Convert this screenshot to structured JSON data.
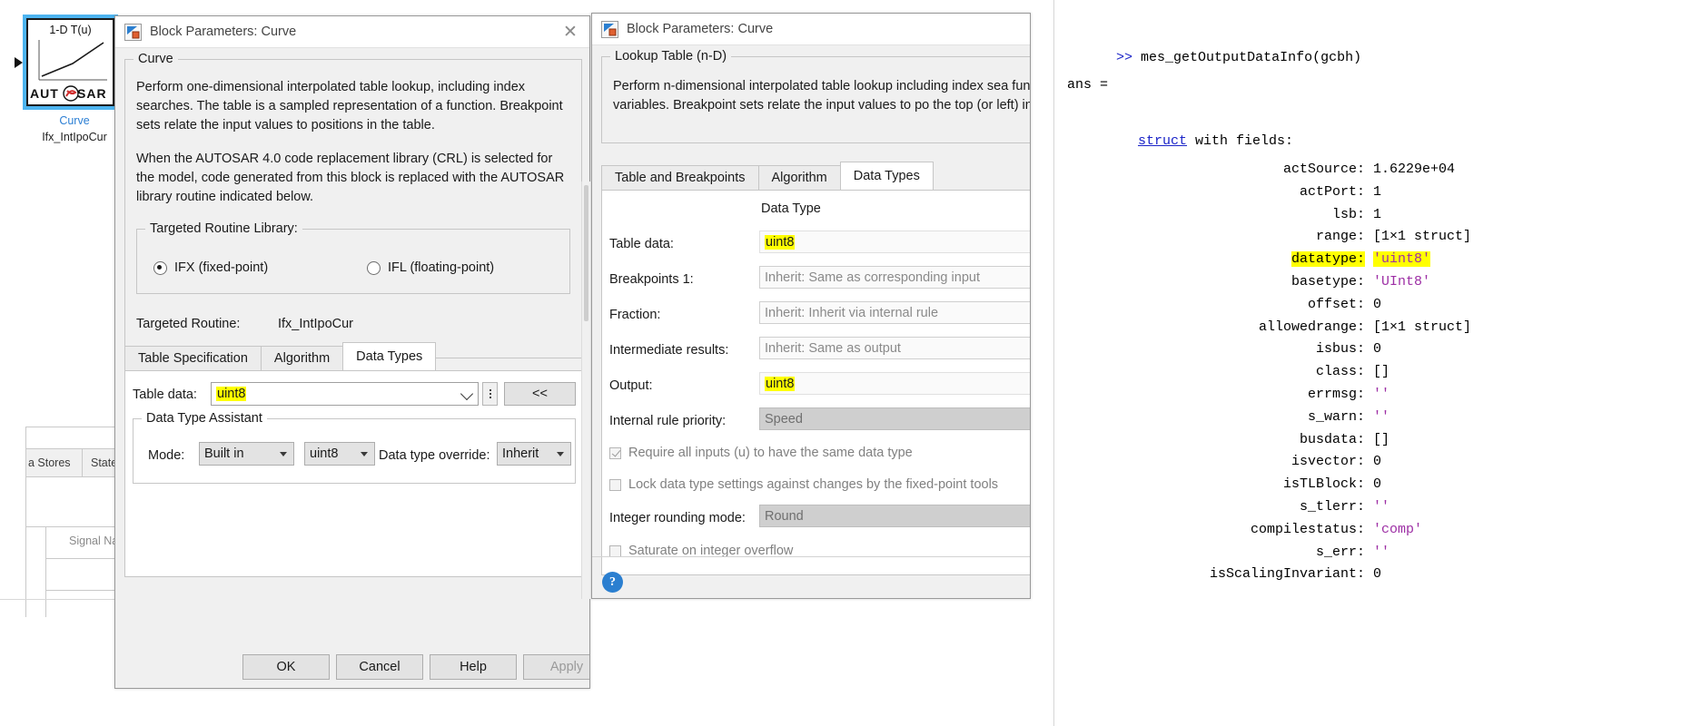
{
  "block": {
    "title": "1-D T(u)",
    "logo_text": "AUT SAR",
    "name": "Curve",
    "routine": "Ifx_IntIpoCur",
    "port_in_icon": "input-port-arrow-icon",
    "port_out_icon": "output-port-arrow-icon"
  },
  "background_table": {
    "tabs": [
      "a Stores",
      "States"
    ],
    "column_header": "Signal Na"
  },
  "dialog1": {
    "title": "Block Parameters: Curve",
    "icon": "simulink-block-icon",
    "close_label": "✕",
    "group_legend": "Curve",
    "description_1": "Perform one-dimensional interpolated table lookup, including index searches. The table is a sampled representation of a function. Breakpoint sets relate the input values to positions in the table.",
    "description_2": "When the AUTOSAR 4.0 code replacement library (CRL) is selected for the model, code generated from this block is replaced with the AUTOSAR library routine indicated below.",
    "routine_group_legend": "Targeted Routine Library:",
    "radio_ifx": "IFX (fixed-point)",
    "radio_ifl": "IFL (floating-point)",
    "radio_selected": "IFX (fixed-point)",
    "targeted_routine_label": "Targeted Routine:",
    "targeted_routine_value": "Ifx_IntIpoCur",
    "tabs": [
      "Table Specification",
      "Algorithm",
      "Data Types"
    ],
    "active_tab": "Data Types",
    "table_data_label": "Table data:",
    "table_data_value": "uint8",
    "dots_button": "more-options-button",
    "collapse_button": "<<",
    "assistant_legend": "Data Type Assistant",
    "mode_label": "Mode:",
    "mode_value": "Built in",
    "builtin_type_value": "uint8",
    "override_label": "Data type override:",
    "override_value": "Inherit",
    "buttons": [
      "OK",
      "Cancel",
      "Help",
      "Apply"
    ],
    "apply_disabled": true
  },
  "dialog2": {
    "title": "Block Parameters: Curve",
    "icon": "simulink-block-icon",
    "group_legend": "Lookup Table (n-D)",
    "description": "Perform n-dimensional interpolated table lookup including index sea function in N variables. Breakpoint sets relate the input values to po the top (or left) input port.",
    "tabs": [
      "Table and Breakpoints",
      "Algorithm",
      "Data Types"
    ],
    "active_tab": "Data Types",
    "column_header": "Data Type",
    "rows": [
      {
        "label": "Table data:",
        "value": "uint8",
        "highlight": true,
        "style": "plain"
      },
      {
        "label": "Breakpoints 1:",
        "value": "Inherit: Same as corresponding input",
        "highlight": false,
        "style": "readonly"
      },
      {
        "label": "Fraction:",
        "value": "Inherit: Inherit via internal rule",
        "highlight": false,
        "style": "readonly"
      },
      {
        "label": "Intermediate results:",
        "value": "Inherit: Same as output",
        "highlight": false,
        "style": "readonly"
      },
      {
        "label": "Output:",
        "value": "uint8",
        "highlight": true,
        "style": "plain"
      },
      {
        "label": "Internal rule priority:",
        "value": "Speed",
        "highlight": false,
        "style": "greyed"
      }
    ],
    "checkboxes": [
      {
        "label": "Require all inputs (u) to have the same data type",
        "checked": true
      },
      {
        "label": "Lock data type settings against changes by the fixed-point tools",
        "checked": false
      },
      {
        "label": "Saturate on integer overflow",
        "checked": false
      }
    ],
    "rounding_label": "Integer rounding mode:",
    "rounding_value": "Round",
    "help_icon": "help-question-icon"
  },
  "console": {
    "prompt": ">>",
    "command": "mes_getOutputDataInfo(gcbh)",
    "ans_line": "ans =",
    "struct_keyword": "struct",
    "struct_suffix": " with fields:",
    "fields": [
      {
        "name": "actSource",
        "value": "1.6229e+04",
        "type": "num",
        "highlight": false
      },
      {
        "name": "actPort",
        "value": "1",
        "type": "num",
        "highlight": false
      },
      {
        "name": "lsb",
        "value": "1",
        "type": "num",
        "highlight": false
      },
      {
        "name": "range",
        "value": "[1×1 struct]",
        "type": "num",
        "highlight": false
      },
      {
        "name": "datatype",
        "value": "'uint8'",
        "type": "str",
        "highlight": true
      },
      {
        "name": "basetype",
        "value": "'UInt8'",
        "type": "str",
        "highlight": false
      },
      {
        "name": "offset",
        "value": "0",
        "type": "num",
        "highlight": false
      },
      {
        "name": "allowedrange",
        "value": "[1×1 struct]",
        "type": "num",
        "highlight": false
      },
      {
        "name": "isbus",
        "value": "0",
        "type": "num",
        "highlight": false
      },
      {
        "name": "class",
        "value": "[]",
        "type": "num",
        "highlight": false
      },
      {
        "name": "errmsg",
        "value": "''",
        "type": "str",
        "highlight": false
      },
      {
        "name": "s_warn",
        "value": "''",
        "type": "str",
        "highlight": false
      },
      {
        "name": "busdata",
        "value": "[]",
        "type": "num",
        "highlight": false
      },
      {
        "name": "isvector",
        "value": "0",
        "type": "num",
        "highlight": false
      },
      {
        "name": "isTLBlock",
        "value": "0",
        "type": "num",
        "highlight": false
      },
      {
        "name": "s_tlerr",
        "value": "''",
        "type": "str",
        "highlight": false
      },
      {
        "name": "compilestatus",
        "value": "'comp'",
        "type": "str",
        "highlight": false
      },
      {
        "name": "s_err",
        "value": "''",
        "type": "str",
        "highlight": false
      },
      {
        "name": "isScalingInvariant",
        "value": "0",
        "type": "num",
        "highlight": false
      }
    ]
  },
  "colors": {
    "highlight": "#ffff00",
    "block_select": "#4db4f0",
    "link_blue": "#1b24c8",
    "string_purple": "#9d2fa5"
  }
}
